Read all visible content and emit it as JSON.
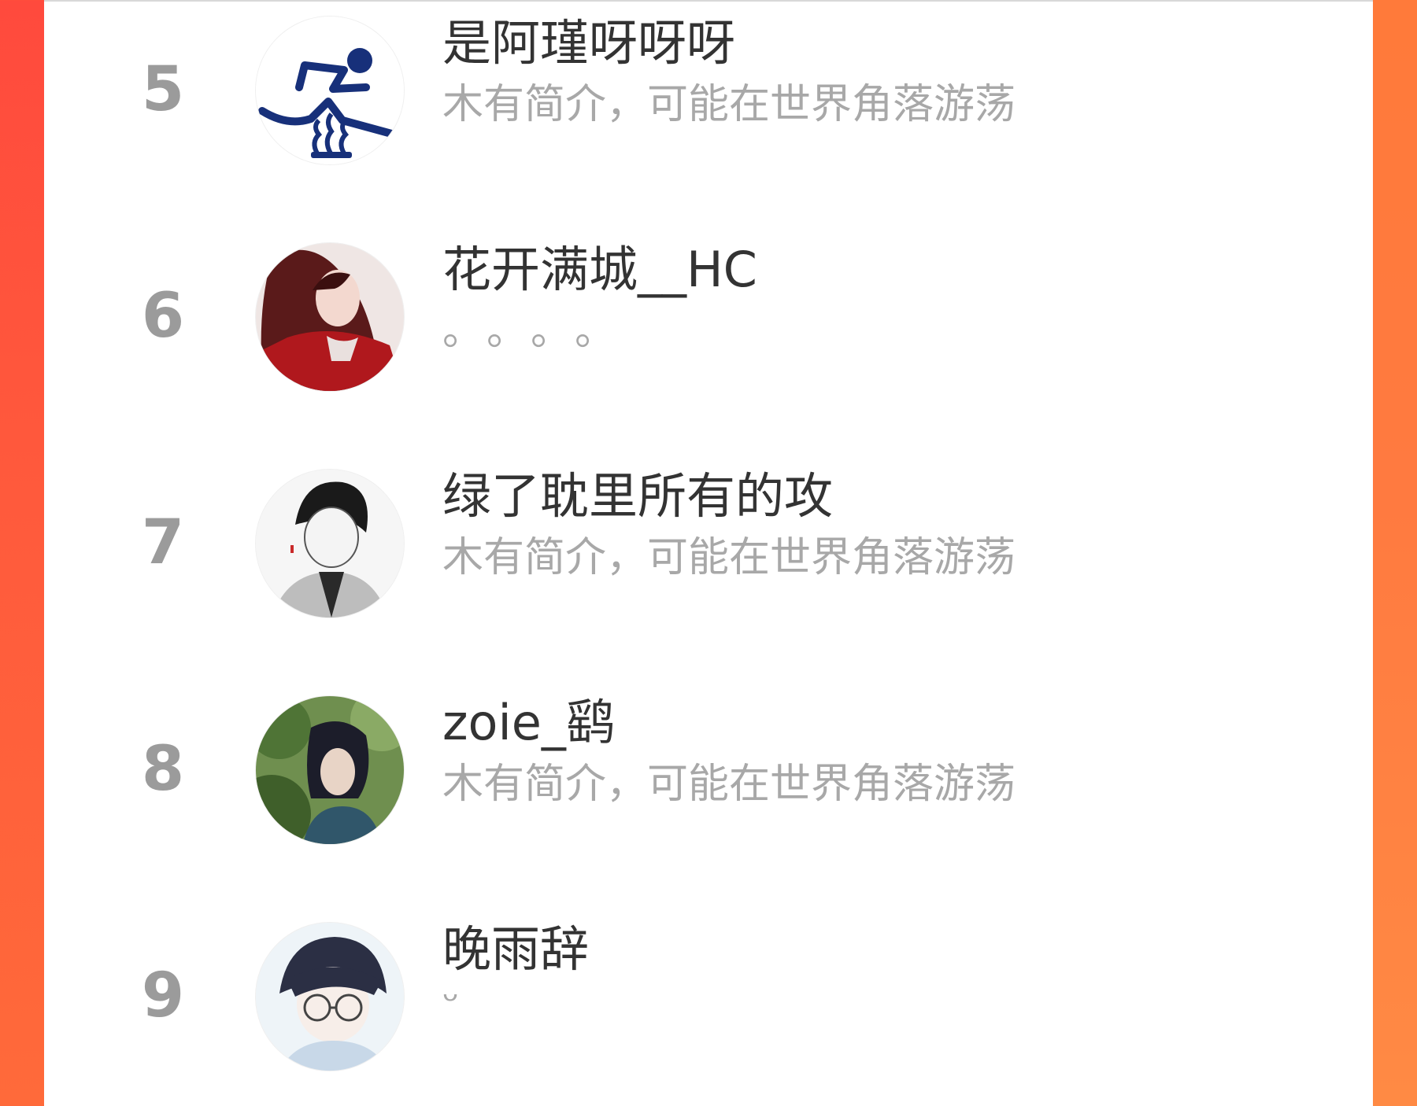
{
  "leaderboard": {
    "rows": [
      {
        "rank": "5",
        "name": "是阿瑾呀呀呀",
        "bio": "木有简介，可能在世界角落游荡",
        "avatar_icon": "runner-logo-icon"
      },
      {
        "rank": "6",
        "name": "花开满城__HC",
        "bio": "。。。。",
        "avatar_icon": "red-robed-character-avatar"
      },
      {
        "rank": "7",
        "name": "绿了耽里所有的攻",
        "bio": "木有简介，可能在世界角落游荡",
        "avatar_icon": "sketch-boy-avatar"
      },
      {
        "rank": "8",
        "name": "zoie_鹞",
        "bio": "木有简介，可能在世界角落游荡",
        "avatar_icon": "cosplay-photo-avatar"
      },
      {
        "rank": "9",
        "name": "晚雨辞",
        "bio": "ᵕ",
        "avatar_icon": "glasses-boy-avatar"
      }
    ]
  },
  "colors": {
    "background_left": "#ff4a3d",
    "background_right": "#ff7a3a",
    "rank": "#9b9b9b",
    "name": "#333333",
    "bio": "#a8a8a8"
  }
}
